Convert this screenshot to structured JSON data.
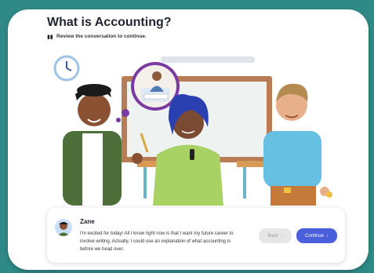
{
  "header": {
    "title": "What is Accounting?",
    "instruction": "Review the conversation to continue."
  },
  "dialog": {
    "speaker": "Zane",
    "message": "I'm excited for today! All I know right now is that I want my future career to involve writing. Actually, I could use an explanation of what accounting is before we head over."
  },
  "buttons": {
    "back": "Back",
    "continue": "Continue"
  },
  "icons": {
    "book": "book-icon",
    "back": "arrow-up-icon",
    "continue": "arrow-down-icon",
    "clock": "clock-icon"
  },
  "colors": {
    "accent": "#4a5fdb",
    "background": "#2f8a87",
    "thought_bubble": "#7a3aa0"
  }
}
